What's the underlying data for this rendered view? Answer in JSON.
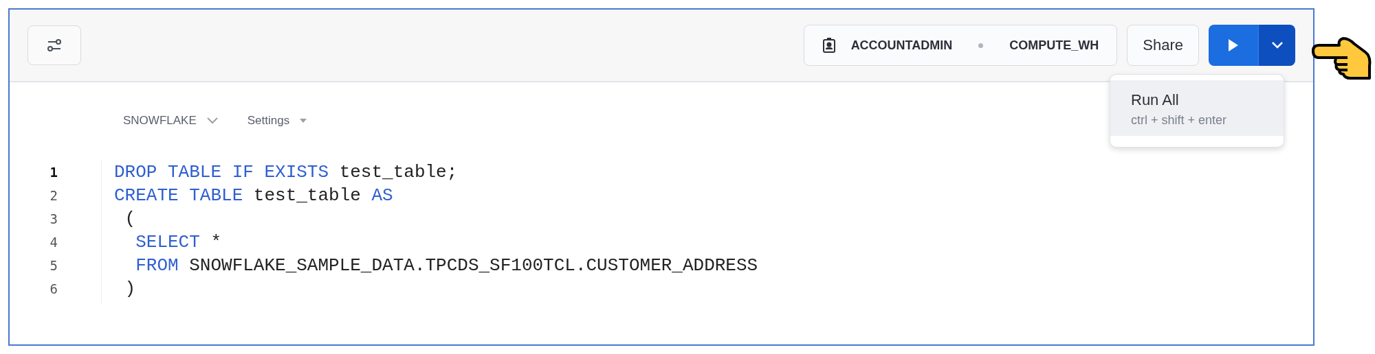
{
  "toolbar": {
    "context": {
      "role": "ACCOUNTADMIN",
      "warehouse": "COMPUTE_WH"
    },
    "share_button": "Share"
  },
  "run_menu": {
    "expanded": true,
    "items": [
      {
        "label": "Run All",
        "shortcut": "ctrl + shift + enter",
        "selected": true
      }
    ]
  },
  "editor": {
    "selectors": [
      {
        "label": "SNOWFLAKE",
        "kind": "chevron"
      },
      {
        "label": "Settings",
        "kind": "triangle"
      }
    ],
    "lines": [
      {
        "number": "1",
        "active": true,
        "tokens": [
          {
            "text": "DROP TABLE IF EXISTS",
            "kind": "keyword"
          },
          {
            "text": " test_table;",
            "kind": "plain"
          }
        ]
      },
      {
        "number": "2",
        "active": false,
        "tokens": [
          {
            "text": "CREATE TABLE",
            "kind": "keyword"
          },
          {
            "text": " test_table ",
            "kind": "plain"
          },
          {
            "text": "AS",
            "kind": "keyword"
          }
        ]
      },
      {
        "number": "3",
        "active": false,
        "tokens": [
          {
            "text": " (",
            "kind": "plain"
          }
        ]
      },
      {
        "number": "4",
        "active": false,
        "tokens": [
          {
            "text": "  SELECT",
            "kind": "keyword"
          },
          {
            "text": " *",
            "kind": "plain"
          }
        ]
      },
      {
        "number": "5",
        "active": false,
        "tokens": [
          {
            "text": "  FROM",
            "kind": "keyword"
          },
          {
            "text": " SNOWFLAKE_SAMPLE_DATA.TPCDS_SF100TCL.CUSTOMER_ADDRESS",
            "kind": "plain"
          }
        ]
      },
      {
        "number": "6",
        "active": false,
        "tokens": [
          {
            "text": " )",
            "kind": "plain"
          }
        ]
      }
    ]
  }
}
